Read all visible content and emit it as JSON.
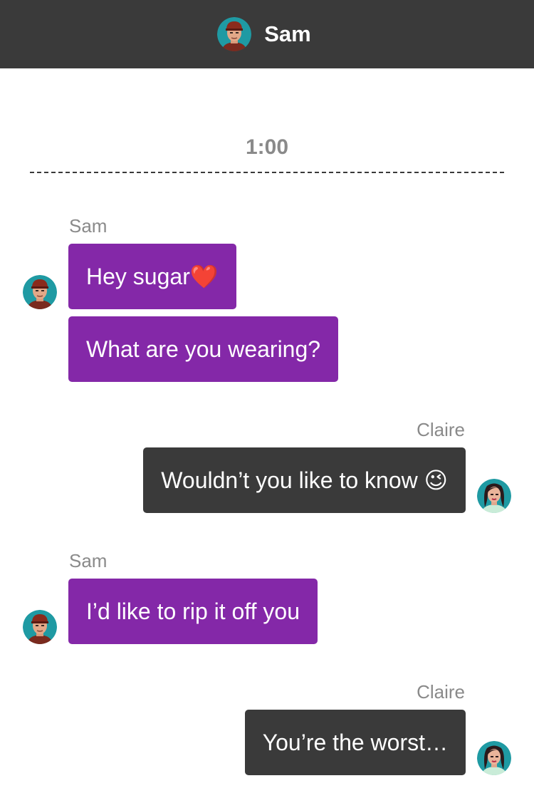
{
  "header": {
    "contact_name": "Sam",
    "avatar_icon": "sam-avatar"
  },
  "timer": "1:00",
  "colors": {
    "header_bg": "#3a3a3a",
    "sam_bubble": "#8428a8",
    "claire_bubble": "#3a3a3a",
    "meta_text": "#8a8a8a"
  },
  "messages": [
    {
      "sender": "Sam",
      "text": "Hey sugar❤️"
    },
    {
      "sender": "Sam",
      "text": "What are you wearing?"
    },
    {
      "sender": "Claire",
      "text": "Wouldn’t you like to know 😉"
    },
    {
      "sender": "Sam",
      "text": "I’d like to rip it off you"
    },
    {
      "sender": "Claire",
      "text": "You’re the worst…"
    }
  ],
  "groups": {
    "g1_sender": "Sam",
    "g2_sender": "Claire",
    "g3_sender": "Sam",
    "g4_sender": "Claire"
  }
}
